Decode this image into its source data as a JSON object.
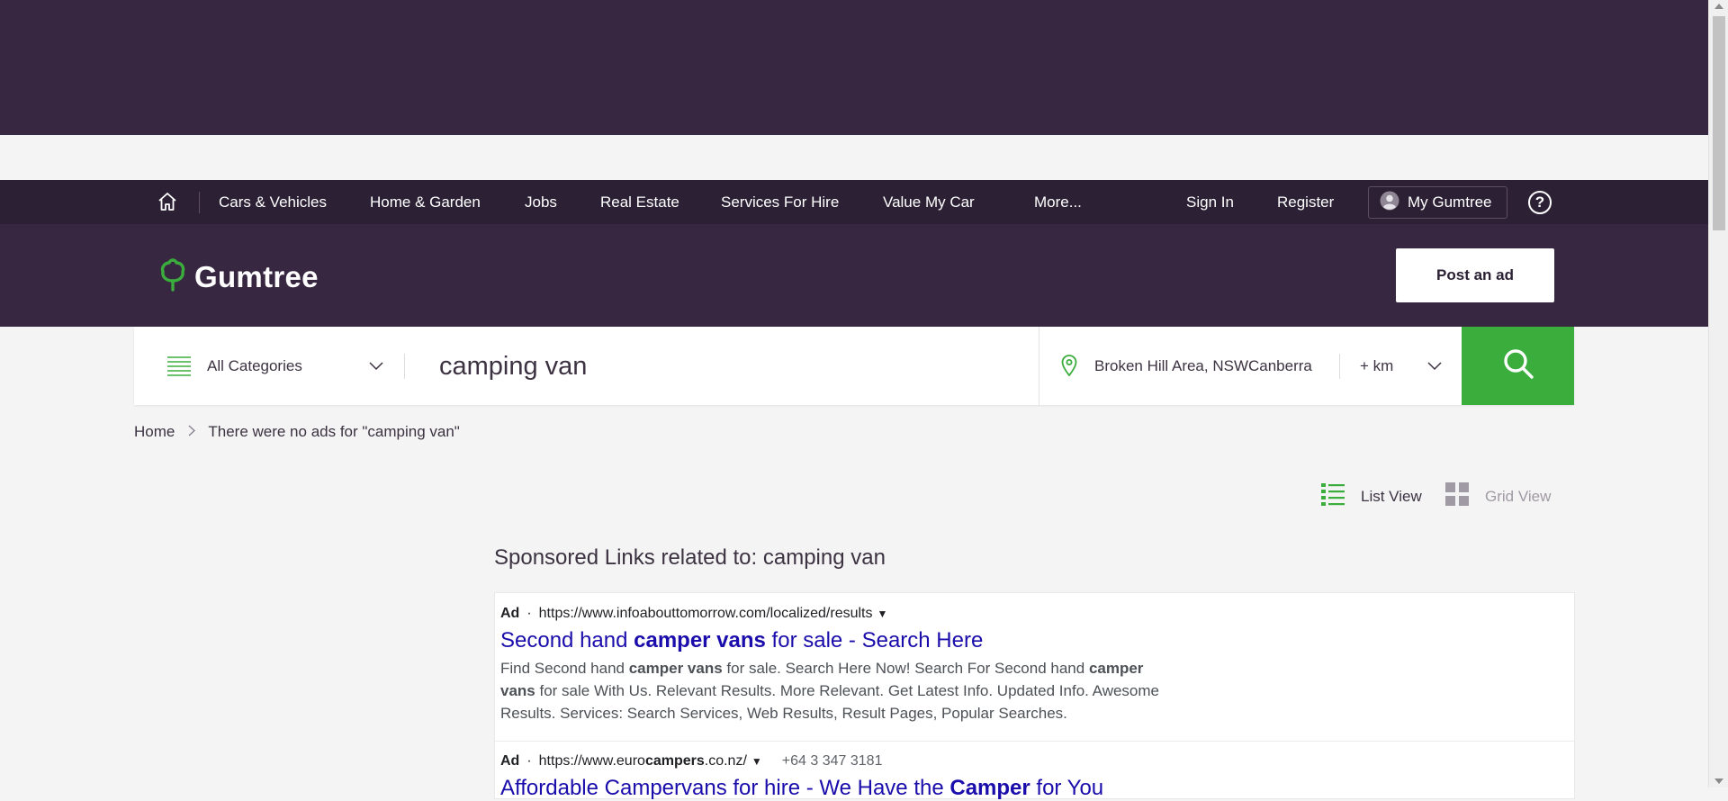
{
  "nav": {
    "items": [
      {
        "label": "Cars & Vehicles"
      },
      {
        "label": "Home & Garden"
      },
      {
        "label": "Jobs"
      },
      {
        "label": "Real Estate"
      },
      {
        "label": "Services For Hire"
      },
      {
        "label": "Value My Car"
      },
      {
        "label": "More..."
      }
    ],
    "sign_in": "Sign In",
    "register": "Register",
    "my_gumtree": "My Gumtree",
    "help": "?"
  },
  "header": {
    "logo_text": "Gumtree",
    "post_ad": "Post an ad"
  },
  "search": {
    "category": "All Categories",
    "query": "camping van",
    "location": "Broken Hill Area, NSWCanberra",
    "radius": "+ km"
  },
  "breadcrumb": {
    "home": "Home",
    "current": "There were no ads for \"camping van\""
  },
  "view": {
    "list": "List View",
    "grid": "Grid View"
  },
  "sponsored": {
    "title": "Sponsored Links related to: camping van",
    "ads": [
      {
        "badge": "Ad",
        "url": "https://www.infoabouttomorrow.com/localized/results",
        "title_pre": "Second hand ",
        "title_bold": "camper vans",
        "title_post": " for sale - Search Here",
        "desc_1": "Find Second hand ",
        "desc_b1": "camper vans",
        "desc_2": " for sale. Search Here Now! Search For Second hand ",
        "desc_b2": "camper vans",
        "desc_3": " for sale With Us. Relevant Results. More Relevant. Get Latest Info. Updated Info. Awesome Results. Services: Search Services, Web Results, Result Pages, Popular Searches."
      },
      {
        "badge": "Ad",
        "url_pre": "https://www.euro",
        "url_bold": "campers",
        "url_post": ".co.nz/",
        "phone": "+64 3 347 3181",
        "title_pre": "Affordable Campervans for hire - We Have the ",
        "title_bold": "Camper",
        "title_post": " for You"
      }
    ]
  },
  "colors": {
    "brand_dark": "#372740",
    "nav_bg": "#2b2034",
    "brand_green": "#3bad3d",
    "ad_link": "#1a0dab"
  }
}
